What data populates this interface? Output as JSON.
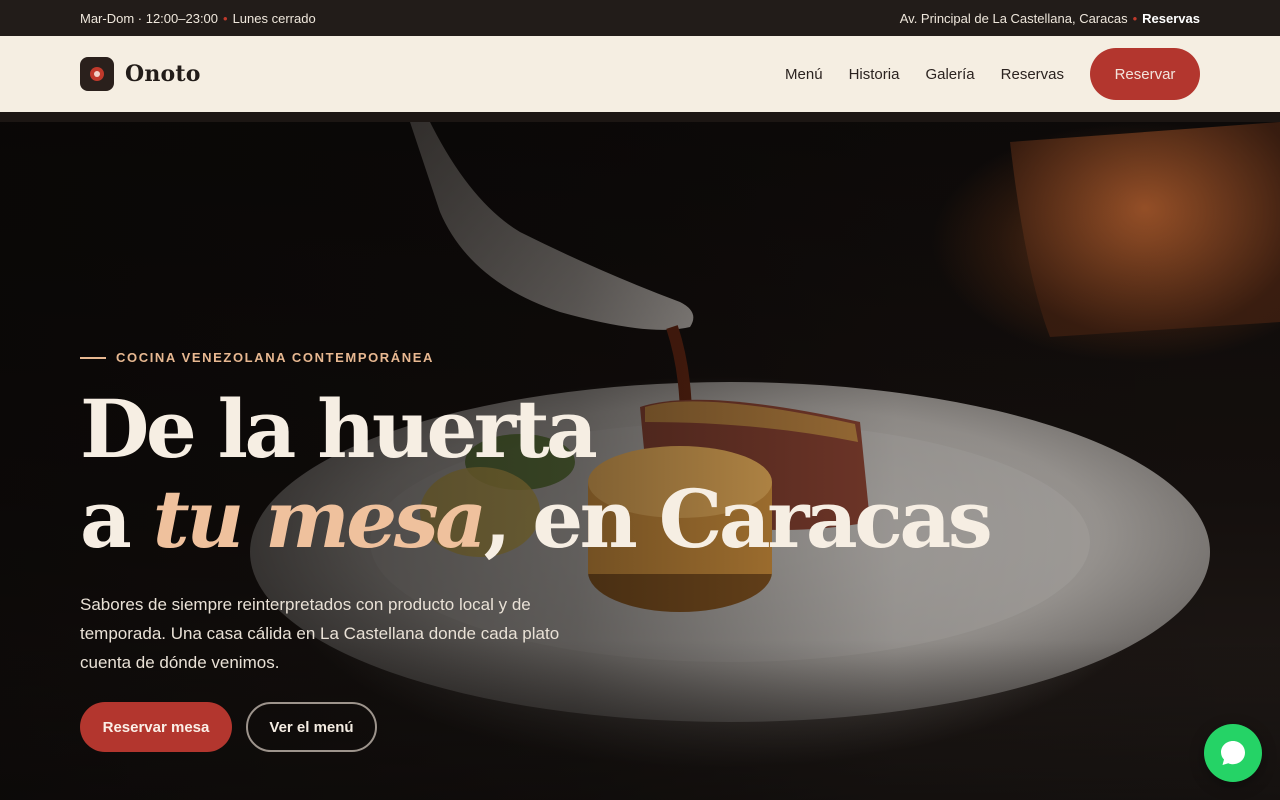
{
  "topbar": {
    "hours": "Mar-Dom · 12:00–23:00",
    "closed": "Lunes cerrado",
    "address": "Av. Principal de La Castellana, Caracas",
    "reservations": "Reservas"
  },
  "nav": {
    "brand": "Onoto",
    "items": [
      {
        "label": "Menú"
      },
      {
        "label": "Historia"
      },
      {
        "label": "Galería"
      },
      {
        "label": "Reservas"
      }
    ],
    "cta": "Reservar"
  },
  "hero": {
    "eyebrow": "COCINA VENEZOLANA CONTEMPORÁNEA",
    "headline_line1": "De la huerta",
    "headline_prefix": "a ",
    "headline_accent": "tu mesa",
    "headline_suffix": ", en Caracas",
    "lead": "Sabores de siempre reinterpretados con producto local y de temporada. Una casa cálida en La Castellana donde cada plato cuenta de dónde venimos.",
    "primary_button": "Reservar mesa",
    "secondary_button": "Ver el menú"
  },
  "icons": {
    "logo": "onoto-logo-icon",
    "chat": "whatsapp-chat-icon"
  },
  "colors": {
    "brand_red": "#b3362e",
    "accent_peach": "#efc19d",
    "cream": "#f5eee2",
    "dark": "#221c19",
    "whatsapp_green": "#25d366"
  }
}
